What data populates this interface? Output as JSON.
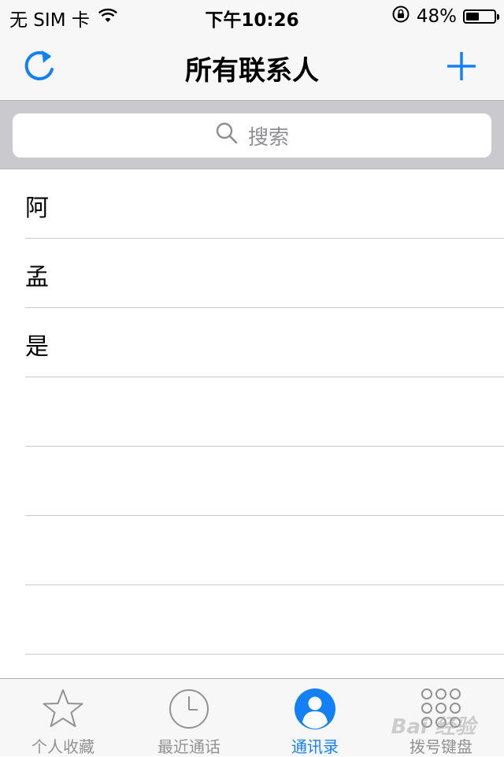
{
  "status_bar": {
    "carrier": "无 SIM 卡",
    "time": "下午10:26",
    "battery_percent_text": "48%",
    "battery_level": 0.48
  },
  "nav": {
    "title": "所有联系人",
    "refresh_icon": "refresh-icon",
    "add_icon": "plus-icon"
  },
  "search": {
    "placeholder": "搜索"
  },
  "contacts": [
    "阿",
    "孟",
    "是",
    "",
    "",
    "",
    ""
  ],
  "tabs": [
    {
      "label": "个人收藏",
      "icon": "star-icon"
    },
    {
      "label": "最近通话",
      "icon": "clock-icon"
    },
    {
      "label": "通讯录",
      "icon": "contacts-icon",
      "active": true
    },
    {
      "label": "拨号键盘",
      "icon": "keypad-icon"
    }
  ],
  "watermark": "Bai 经验",
  "colors": {
    "accent": "#1380f6",
    "inactive": "#929292",
    "bar_background": "#f7f7f7",
    "search_background": "#c9c9ce"
  }
}
